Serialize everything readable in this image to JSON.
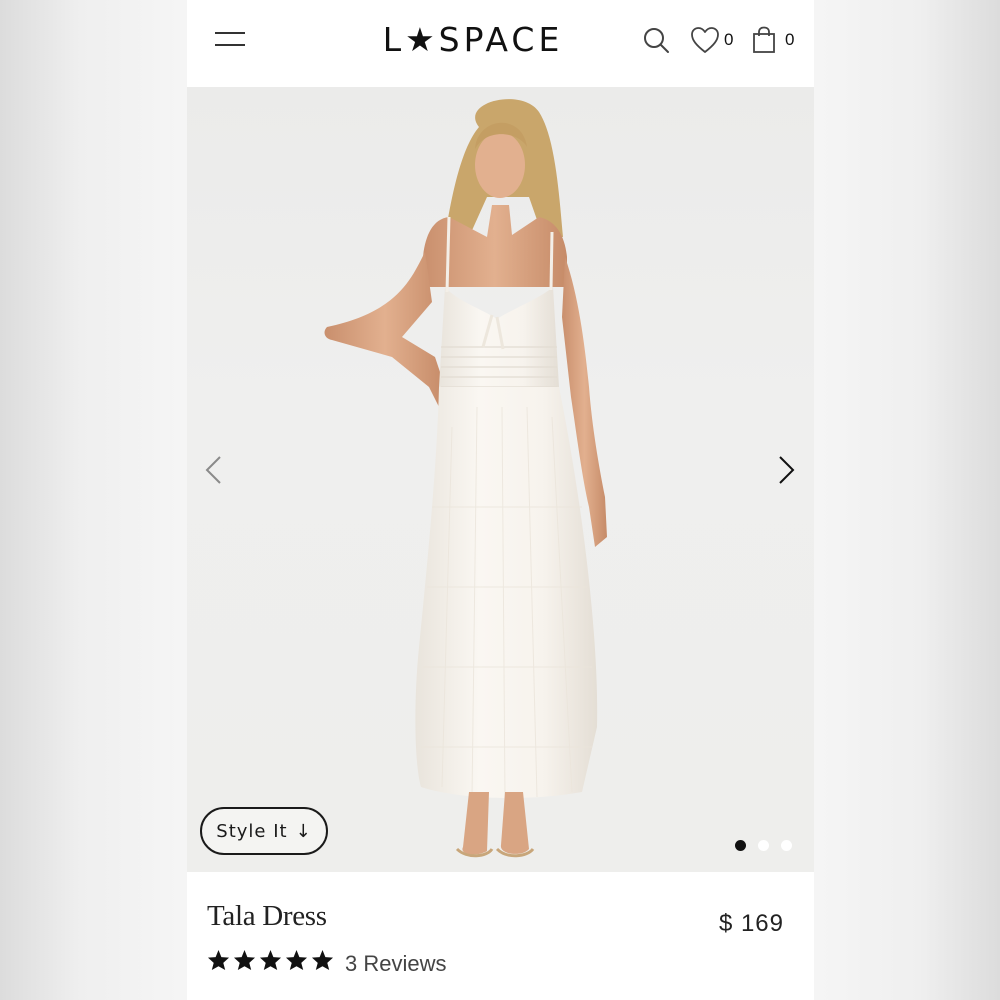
{
  "header": {
    "logo_text": "L★SPACE",
    "wishlist_count": "0",
    "cart_count": "0",
    "icons": [
      "menu-icon",
      "search-icon",
      "heart-icon",
      "bag-icon"
    ]
  },
  "gallery": {
    "style_it_label": "Style It",
    "style_it_arrow": "↓",
    "current_slide": 1,
    "slide_count": 3
  },
  "product": {
    "name": "Tala Dress",
    "price": "$ 169",
    "rating": 5,
    "reviews_label": "3 Reviews"
  },
  "colors": {
    "text": "#111111",
    "dress": "#f6f2ec",
    "skin": "#d9a583",
    "hair": "#c8a46a"
  }
}
